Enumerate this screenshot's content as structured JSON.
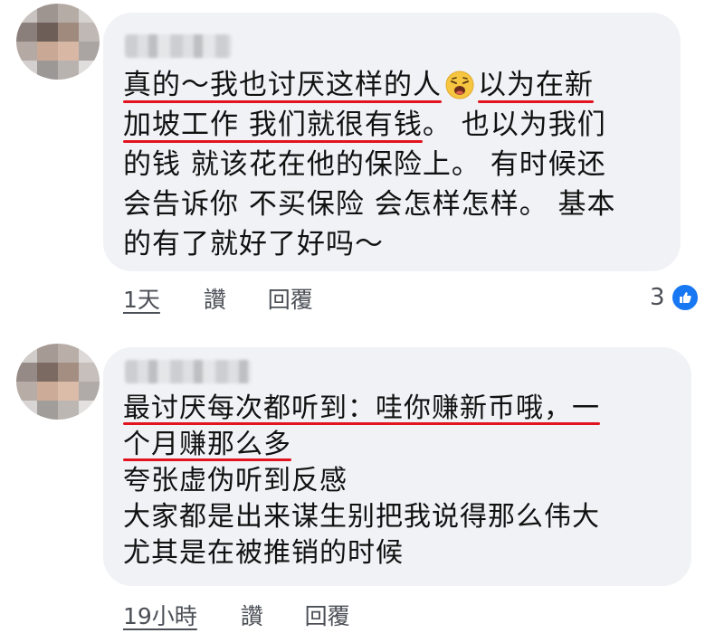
{
  "comments": [
    {
      "lines": [
        {
          "parts": [
            {
              "t": "真的～我也讨厌这样的人",
              "u": true
            },
            {
              "emoji": "weary-face-icon"
            },
            {
              "t": " 以为在新",
              "u": true
            }
          ]
        },
        {
          "parts": [
            {
              "t": "加坡工作 我们就很有钱",
              "u": true
            },
            {
              "t": "。 也以为我们",
              "u": false
            }
          ]
        },
        {
          "parts": [
            {
              "t": "的钱 就该花在他的保险上。 有时候还",
              "u": false
            }
          ]
        },
        {
          "parts": [
            {
              "t": "会告诉你 不买保险 会怎样怎样。 基本",
              "u": false
            }
          ]
        },
        {
          "parts": [
            {
              "t": "的有了就好了好吗～",
              "u": false
            }
          ]
        }
      ],
      "time": "1天",
      "like_label": "讚",
      "reply_label": "回覆",
      "reaction_count": "3",
      "reaction_icon": "like-icon"
    },
    {
      "lines": [
        {
          "parts": [
            {
              "t": "最讨厌每次都听到：哇你赚新币哦，一",
              "u": true
            }
          ]
        },
        {
          "parts": [
            {
              "t": "个月赚那么多",
              "u": true
            }
          ]
        },
        {
          "parts": [
            {
              "t": "夸张虚伪听到反感",
              "u": false
            }
          ]
        },
        {
          "parts": [
            {
              "t": "大家都是出来谋生别把我说得那么伟大",
              "u": false
            }
          ]
        },
        {
          "parts": [
            {
              "t": "尤其是在被推销的时候",
              "u": false
            }
          ]
        }
      ],
      "time": "19小時",
      "like_label": "讚",
      "reply_label": "回覆"
    }
  ],
  "colors": {
    "bubble": "#f0f2f5",
    "underline": "#e2141f",
    "like_blue": "#1877f2",
    "meta_text": "#4b4f56"
  }
}
